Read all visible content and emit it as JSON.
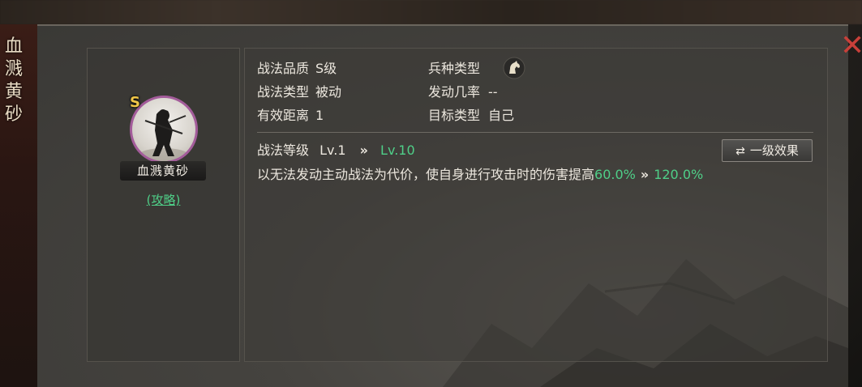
{
  "window": {
    "vertical_title": [
      "血",
      "溅",
      "黄",
      "砂"
    ],
    "close_glyph": "✕"
  },
  "skill": {
    "grade_badge": "S",
    "name_plate": "血溅黄砂",
    "strategy_link": "(攻略)"
  },
  "info": {
    "quality_label": "战法品质",
    "quality_value": "S级",
    "type_label": "战法类型",
    "type_value": "被动",
    "range_label": "有效距离",
    "range_value": "1",
    "troop_label": "兵种类型",
    "troop_icon": "cavalry-horse-icon",
    "trigger_label": "发动几率",
    "trigger_value": "--",
    "target_label": "目标类型",
    "target_value": "自己"
  },
  "level": {
    "label": "战法等级",
    "from": "Lv.1",
    "arrow": "»",
    "to": "Lv.10",
    "effect_button": "一级效果",
    "effect_button_icon": "⇄"
  },
  "description": {
    "text": "以无法发动主动战法为代价，使自身进行攻击时的伤害提高",
    "value_from": "60.0%",
    "arrow": "»",
    "value_to": "120.0%"
  },
  "colors": {
    "accent_green": "#4fcf88",
    "grade_gold": "#f0c648",
    "close_red": "#c8403a",
    "icon_ring": "#a35c9a"
  }
}
